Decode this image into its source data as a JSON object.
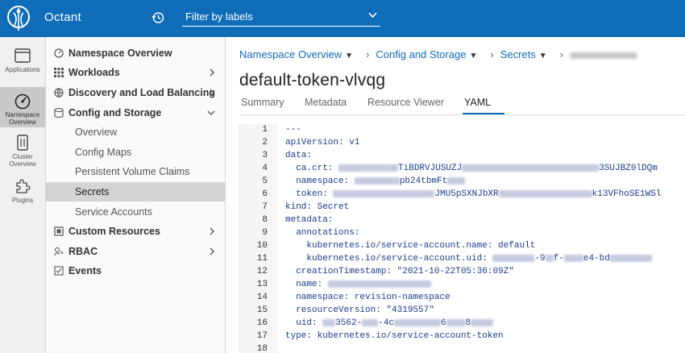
{
  "header": {
    "app_name": "Octant",
    "filter_label": "Filter by labels",
    "brand_color": "#0f6cb8"
  },
  "rail": [
    {
      "label": "Applications",
      "icon": "applications-icon"
    },
    {
      "label_lines": [
        "Namespace",
        "Overview"
      ],
      "icon": "dashboard-gauge-icon",
      "active": true
    },
    {
      "label_lines": [
        "Cluster",
        "Overview"
      ],
      "icon": "cluster-icon"
    },
    {
      "label": "Plugins",
      "icon": "puzzle-icon"
    }
  ],
  "nav": {
    "namespace_overview": "Namespace Overview",
    "workloads": "Workloads",
    "discovery": "Discovery and Load Balancing",
    "config_storage": "Config and Storage",
    "sub": {
      "overview": "Overview",
      "config_maps": "Config Maps",
      "pvc": "Persistent Volume Claims",
      "secrets": "Secrets",
      "service_accounts": "Service Accounts"
    },
    "custom_resources": "Custom Resources",
    "rbac": "RBAC",
    "events": "Events"
  },
  "breadcrumbs": [
    "Namespace Overview",
    "Config and Storage",
    "Secrets"
  ],
  "title": "default-token-vlvqg",
  "tabs": [
    "Summary",
    "Metadata",
    "Resource Viewer",
    "YAML"
  ],
  "active_tab": "YAML",
  "yaml": {
    "l1": "---",
    "l2": "apiVersion: v1",
    "l3": "data:",
    "l4a": "  ca.crt: ",
    "l4b": "TiBDRVJUSUZJ",
    "l4c": "3SUJBZ0lDQm",
    "l5a": "  namespace: ",
    "l5b": "pb24tbmFt",
    "l6a": "  token: ",
    "l6b": "JMU5pSXNJbXR",
    "l6c": "k13VFhoSE1WSl",
    "l7": "kind: Secret",
    "l8": "metadata:",
    "l9": "  annotations:",
    "l10": "    kubernetes.io/service-account.name: default",
    "l11a": "    kubernetes.io/service-account.uid: ",
    "l11b": "-9",
    "l11c": "f-",
    "l11d": "e4-bd",
    "l12": "  creationTimestamp: \"2021-10-22T05:36:09Z\"",
    "l13": "  name: ",
    "l14": "  namespace: revision-namespace",
    "l15": "  resourceVersion: \"4319557\"",
    "l16a": "  uid: ",
    "l16b": "3562-",
    "l16c": "-4c",
    "l16d": "6",
    "l16e": "8",
    "l17": "type: kubernetes.io/service-account-token",
    "l18": ""
  },
  "line_numbers": [
    "1",
    "2",
    "3",
    "4",
    "5",
    "6",
    "7",
    "8",
    "9",
    "10",
    "11",
    "12",
    "13",
    "14",
    "15",
    "16",
    "17",
    "18"
  ]
}
